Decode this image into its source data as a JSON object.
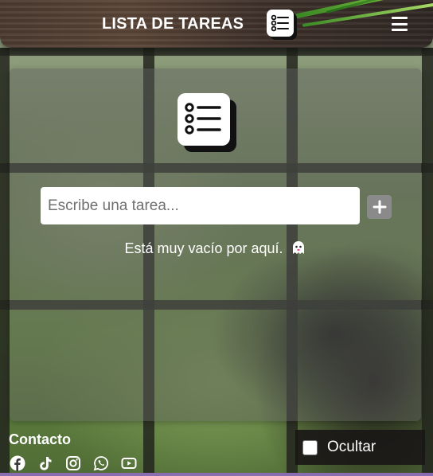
{
  "header": {
    "title": "LISTA DE TAREAS",
    "title_icon": "list-icon",
    "menu_icon": "hamburger-menu-icon"
  },
  "main": {
    "logo_icon": "list-icon",
    "task_input": {
      "value": "",
      "placeholder": "Escribe una tarea..."
    },
    "add_button_icon": "plus-icon",
    "empty_message": "Está muy vacío por aquí.",
    "empty_message_icon": "ghost-icon"
  },
  "footer": {
    "contact_title": "Contacto",
    "socials": [
      {
        "icon": "facebook-icon"
      },
      {
        "icon": "tiktok-icon"
      },
      {
        "icon": "instagram-icon"
      },
      {
        "icon": "whatsapp-icon"
      },
      {
        "icon": "youtube-icon"
      }
    ],
    "hide_toggle": {
      "label": "Ocultar",
      "checked": false
    }
  },
  "colors": {
    "header_wood": "#4b3a30",
    "card_glass": "#5f5f5f",
    "add_button": "#8a8a8a",
    "accent_leaf": "#8fd44a"
  }
}
